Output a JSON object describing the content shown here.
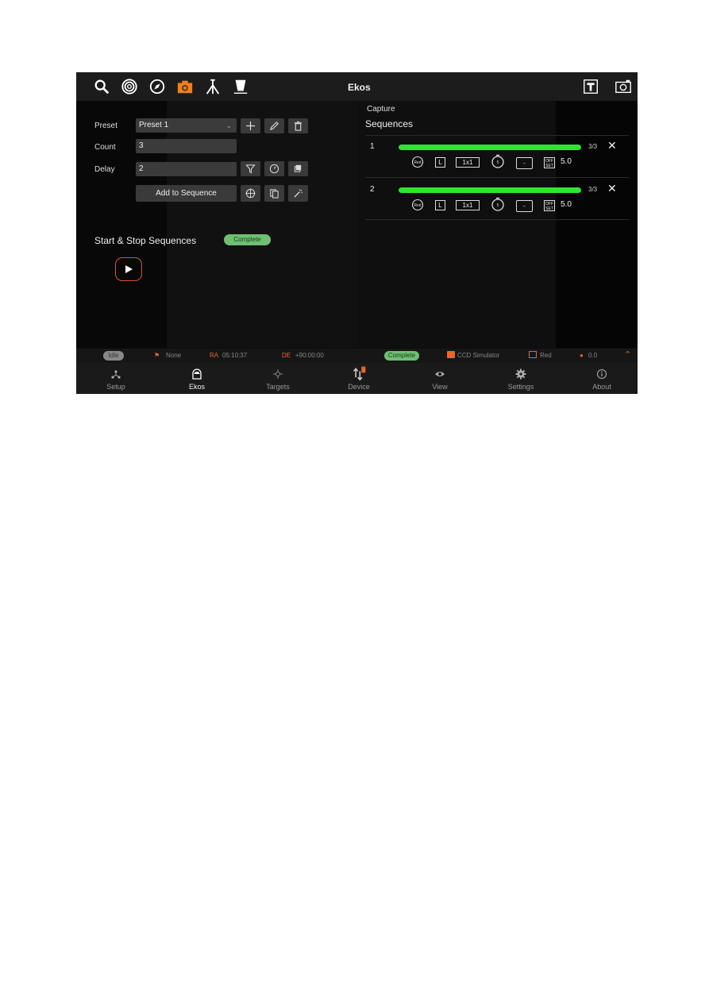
{
  "topbar": {
    "title": "Ekos",
    "left_icons": [
      "search-icon",
      "target-icon",
      "compass-icon",
      "camera-icon",
      "tripod-icon",
      "filter-icon"
    ],
    "right_icons": [
      "text-frame-icon",
      "snapshot-icon"
    ],
    "accent": "#f07f1e"
  },
  "capture": {
    "title": "Capture",
    "preset_label": "Preset",
    "preset_value": "Preset 1",
    "count_label": "Count",
    "count_value": "3",
    "delay_label": "Delay",
    "delay_value": "2",
    "add_to_sequence": "Add to Sequence"
  },
  "sequences": {
    "title": "Sequences",
    "rows": [
      {
        "index": "1",
        "progress": 1.0,
        "count": "3/3",
        "type": "Red",
        "filter": "L",
        "binning": "1x1",
        "exposure": "5",
        "frame": "-",
        "offset": "5.0"
      },
      {
        "index": "2",
        "progress": 1.0,
        "count": "3/3",
        "type": "Red",
        "filter": "L",
        "binning": "1x1",
        "exposure": "5",
        "frame": "-",
        "offset": "5.0"
      }
    ],
    "progress_color": "#2ee62e"
  },
  "start_stop": {
    "title": "Start & Stop Sequences",
    "status": "Complete"
  },
  "statusbar": {
    "mount_status": "Idle",
    "tracking": "None",
    "ra_label": "RA",
    "ra_value": "05:10:37",
    "de_label": "DE",
    "de_value": "+90:00:00",
    "capture_status": "Complete",
    "camera": "CCD Simulator",
    "filter": "Red",
    "temperature": "0.0"
  },
  "bottomnav": {
    "items": [
      {
        "label": "Setup",
        "icon": "setup-icon"
      },
      {
        "label": "Ekos",
        "icon": "ekos-icon",
        "active": true
      },
      {
        "label": "Targets",
        "icon": "targets-icon"
      },
      {
        "label": "Device",
        "icon": "device-icon"
      },
      {
        "label": "View",
        "icon": "view-icon"
      },
      {
        "label": "Settings",
        "icon": "settings-icon"
      },
      {
        "label": "About",
        "icon": "about-icon"
      }
    ]
  }
}
